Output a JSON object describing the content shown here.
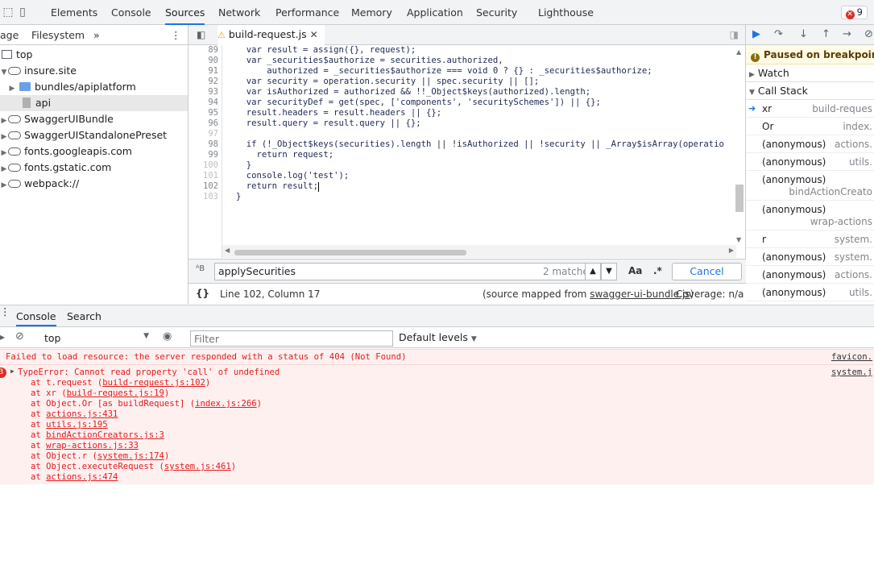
{
  "top_tabs": [
    "Elements",
    "Console",
    "Sources",
    "Network",
    "Performance",
    "Memory",
    "Application",
    "Security",
    "Lighthouse"
  ],
  "error_count": "9",
  "navigator": {
    "tabs": [
      "age",
      "Filesystem"
    ],
    "more": "»",
    "tree": [
      "top",
      "insure.site",
      "bundles/apiplatform",
      "api",
      "SwaggerUIBundle",
      "SwaggerUIStandalonePreset",
      "fonts.googleapis.com",
      "fonts.gstatic.com",
      "webpack://"
    ]
  },
  "editor": {
    "file_tab": "build-request.js",
    "line_numbers": [
      "89",
      "90",
      "91",
      "92",
      "93",
      "94",
      "95",
      "96",
      "97",
      "98",
      "99",
      "100",
      "101",
      "102",
      "103"
    ],
    "lines": [
      "  var result = assign({}, request);",
      "  var _securities$authorize = securities.authorized,",
      "      authorized = _securities$authorize === void 0 ? {} : _securities$authorize;",
      "  var security = operation.security || spec.security || [];",
      "  var isAuthorized = authorized && !!_Object$keys(authorized).length;",
      "  var securityDef = get(spec, ['components', 'securitySchemes']) || {};",
      "  result.headers = result.headers || {};",
      "  result.query = result.query || {};",
      "",
      "  if (!_Object$keys(securities).length || !isAuthorized || !security || _Array$isArray(operatio",
      "    return request;",
      "  }",
      "  console.log('test');",
      "  return result;",
      "}"
    ],
    "find_value": "applySecurities",
    "find_count": "2 matches",
    "find_case": "Aa",
    "find_regex": ".*",
    "cancel_label": "Cancel",
    "format_icon": "{}",
    "position": "Line 102, Column 17",
    "source_mapped_prefix": "(source mapped from ",
    "source_mapped_file": "swagger-ui-bundle.js",
    "source_mapped_suffix": ")",
    "coverage": "Coverage: n/a"
  },
  "debugger": {
    "paused": "Paused on breakpoint",
    "watch": "Watch",
    "call_stack": "Call Stack",
    "frames": [
      {
        "name": "xr",
        "loc": "build-reques"
      },
      {
        "name": "Or",
        "loc": "index."
      },
      {
        "name": "(anonymous)",
        "loc": "actions."
      },
      {
        "name": "(anonymous)",
        "loc": "utils."
      },
      {
        "name": "(anonymous)",
        "loc": "bindActionCreato"
      },
      {
        "name": "(anonymous)",
        "loc": "wrap-actions"
      },
      {
        "name": "r",
        "loc": "system."
      },
      {
        "name": "(anonymous)",
        "loc": "system."
      },
      {
        "name": "(anonymous)",
        "loc": "actions."
      },
      {
        "name": "(anonymous)",
        "loc": "utils."
      }
    ]
  },
  "drawer": {
    "tabs": [
      "Console",
      "Search"
    ],
    "context": "top",
    "filter_placeholder": "Filter",
    "levels": "Default levels",
    "messages": [
      {
        "text": "Failed to load resource: the server responded with a status of 404 (Not Found)",
        "source": "favicon."
      },
      {
        "text": "TypeError: Cannot read property 'call' of undefined",
        "source": "system.j",
        "count": "3"
      }
    ],
    "stack": [
      {
        "pre": "at t.request (",
        "link": "build-request.js:102",
        "post": ")"
      },
      {
        "pre": "at xr (",
        "link": "build-request.js:19",
        "post": ")"
      },
      {
        "pre": "at Object.Or [as buildRequest] (",
        "link": "index.js:266",
        "post": ")"
      },
      {
        "pre": "at ",
        "link": "actions.js:431",
        "post": ""
      },
      {
        "pre": "at ",
        "link": "utils.js:195",
        "post": ""
      },
      {
        "pre": "at ",
        "link": "bindActionCreators.js:3",
        "post": ""
      },
      {
        "pre": "at ",
        "link": "wrap-actions.js:33",
        "post": ""
      },
      {
        "pre": "at Object.r (",
        "link": "system.js:174",
        "post": ")"
      },
      {
        "pre": "at Object.executeRequest (",
        "link": "system.js:461",
        "post": ")"
      },
      {
        "pre": "at ",
        "link": "actions.js:474",
        "post": ""
      }
    ]
  },
  "colors": {
    "accent": "#1a73e8",
    "error": "#e21b1b",
    "error_bg": "#fff0f0",
    "paused_bg": "#fffbe5"
  }
}
